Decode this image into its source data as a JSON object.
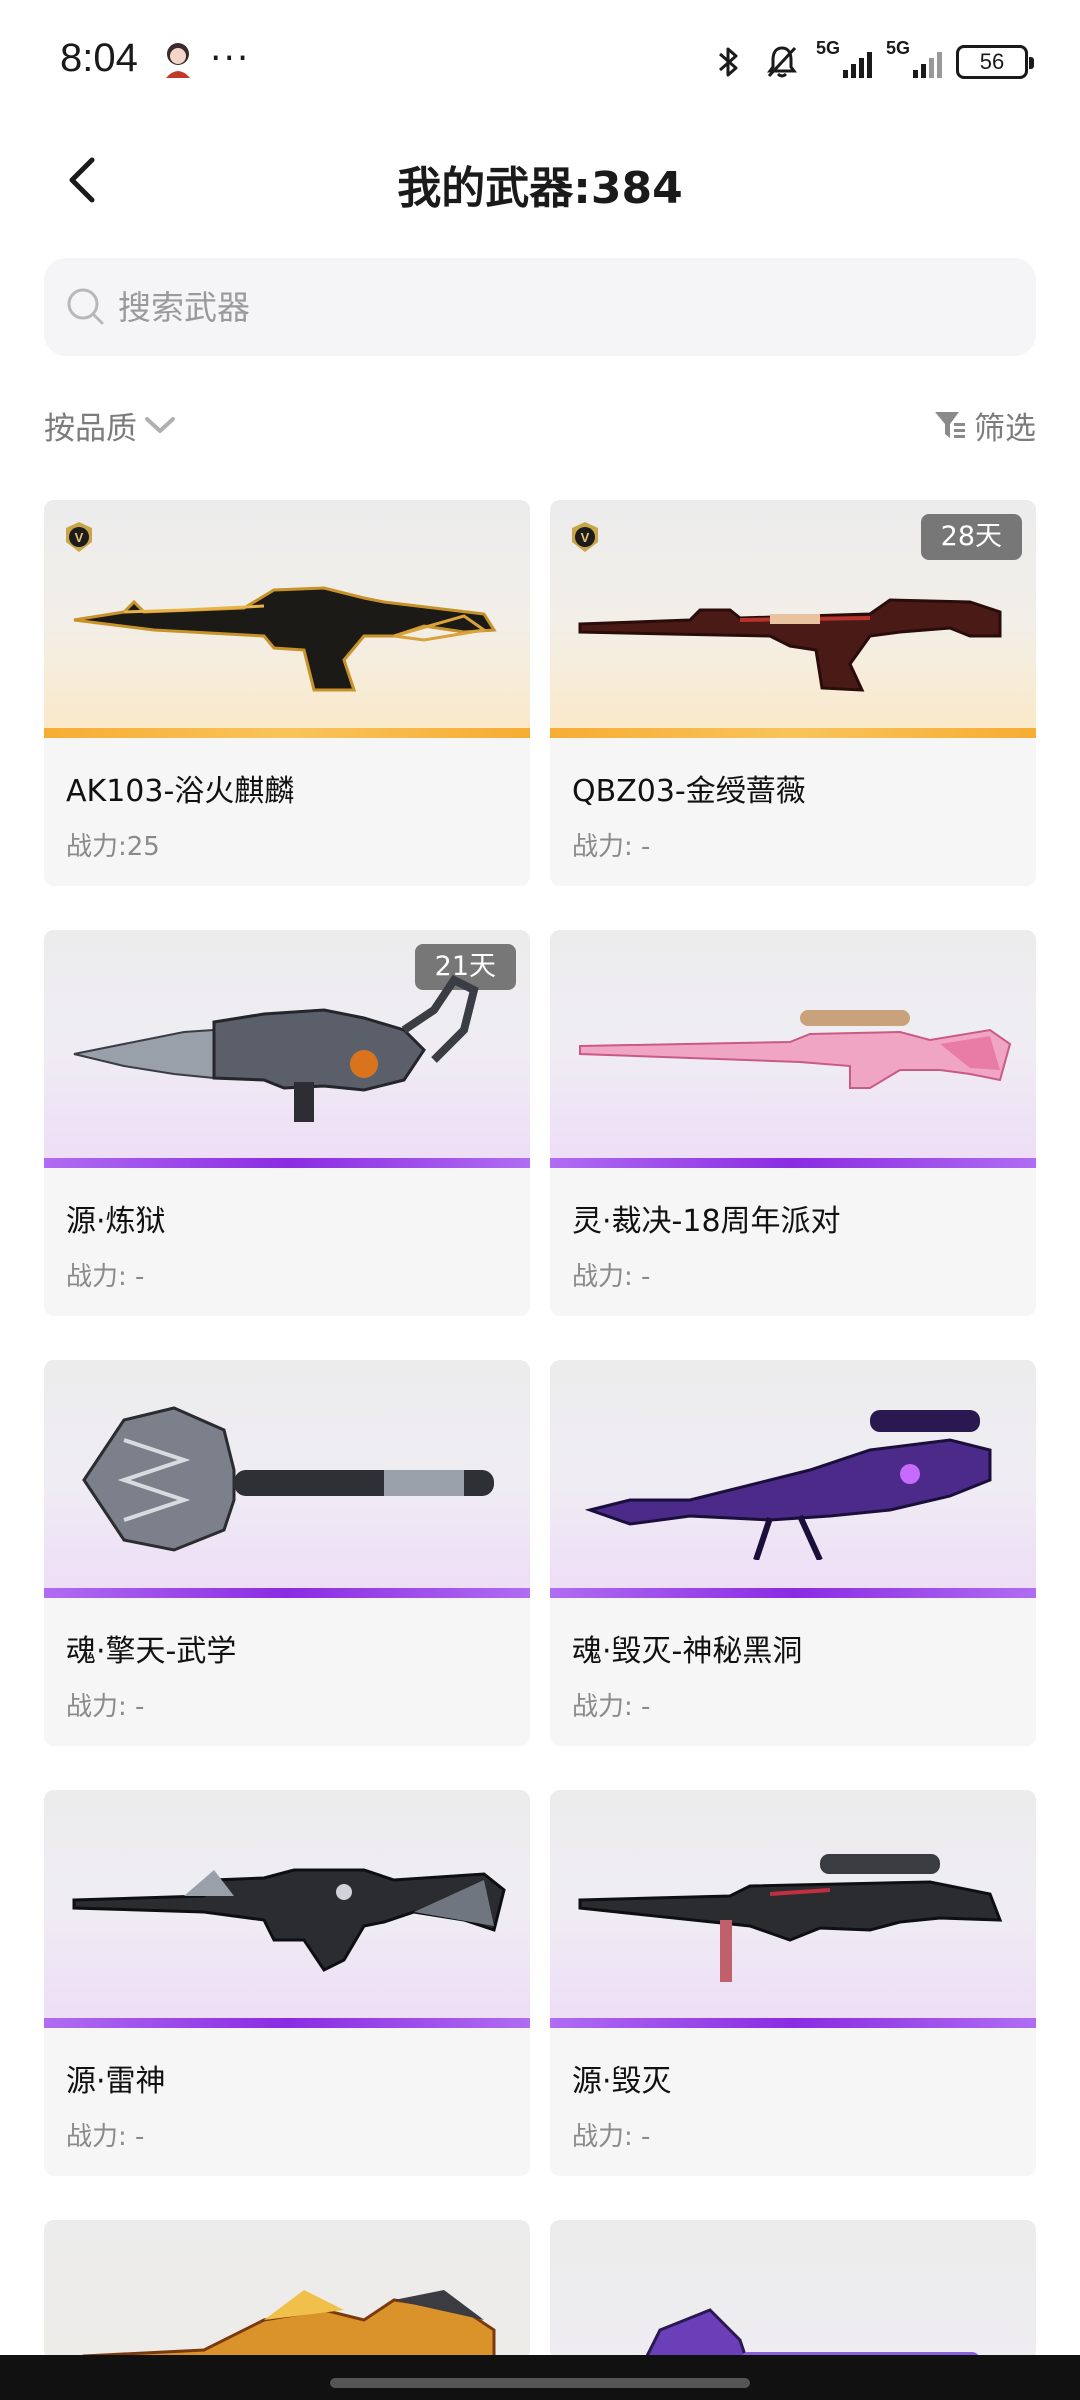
{
  "status_bar": {
    "time": "8:04",
    "dots": "···",
    "network_1": "5G",
    "network_2": "5G",
    "battery": "56"
  },
  "header": {
    "title": "我的武器:384"
  },
  "search": {
    "placeholder": "搜索武器"
  },
  "toolbar": {
    "sort_label": "按品质",
    "filter_label": "筛选"
  },
  "colors": {
    "gold_stripe": "#f6ad34",
    "purple_stripe": "#8a2be2",
    "badge_bg": "#777777"
  },
  "weapons": [
    {
      "name": "AK103-浴火麒麟",
      "power": "战力:25",
      "rarity": "gold",
      "vip": true,
      "days": ""
    },
    {
      "name": "QBZ03-金绶蔷薇",
      "power": "战力: -",
      "rarity": "gold",
      "vip": true,
      "days": "28天"
    },
    {
      "name": "源·炼狱",
      "power": "战力: -",
      "rarity": "purple",
      "vip": false,
      "days": "21天"
    },
    {
      "name": "灵·裁决-18周年派对",
      "power": "战力: -",
      "rarity": "purple",
      "vip": false,
      "days": ""
    },
    {
      "name": "魂·擎天-武学",
      "power": "战力: -",
      "rarity": "purple",
      "vip": false,
      "days": ""
    },
    {
      "name": "魂·毁灭-神秘黑洞",
      "power": "战力: -",
      "rarity": "purple",
      "vip": false,
      "days": ""
    },
    {
      "name": "源·雷神",
      "power": "战力: -",
      "rarity": "purple",
      "vip": false,
      "days": ""
    },
    {
      "name": "源·毁灭",
      "power": "战力: -",
      "rarity": "purple",
      "vip": false,
      "days": ""
    },
    {
      "name": "",
      "power": "",
      "rarity": "gold",
      "vip": false,
      "days": ""
    },
    {
      "name": "",
      "power": "",
      "rarity": "purple",
      "vip": false,
      "days": ""
    }
  ]
}
